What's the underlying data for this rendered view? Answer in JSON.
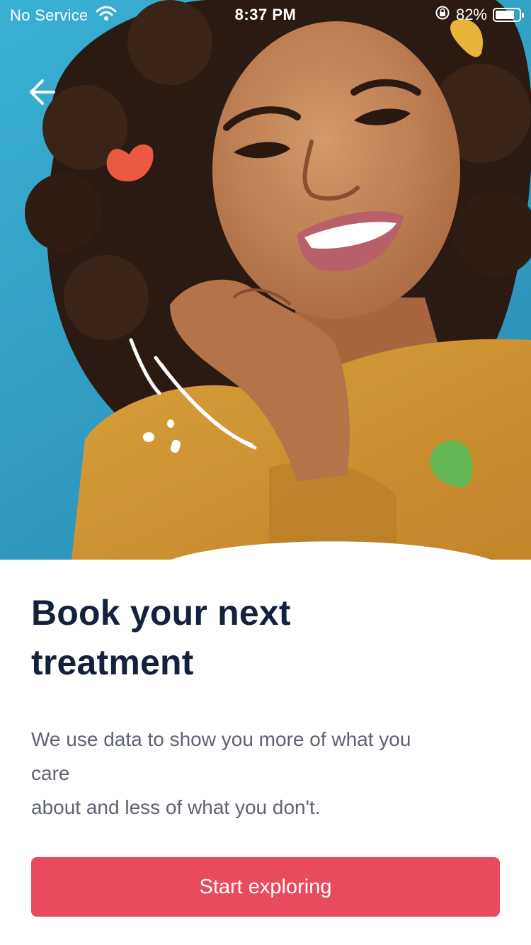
{
  "status_bar": {
    "carrier": "No Service",
    "time": "8:37 PM",
    "battery_percent": "82%",
    "battery_level": 0.82,
    "icons": [
      "wifi-icon",
      "orientation-lock-icon",
      "battery-icon"
    ]
  },
  "hero": {
    "image": "woman-smiling-photo",
    "back_icon": "back-arrow-icon",
    "decorations": [
      "red-leaf-icon",
      "yellow-leaf-icon",
      "green-leaf-icon",
      "white-strokes-icon"
    ]
  },
  "onboarding": {
    "title_line1": "Book your next",
    "title_line2": "treatment",
    "description_line1": "We use data to show you more of what you",
    "description_line2": "care",
    "description_line3": "about and less of what you don't.",
    "cta_label": "Start exploring"
  },
  "colors": {
    "title": "#14213d",
    "body_text": "#5e6372",
    "cta_background": "#e94b5e",
    "cta_text": "#ffffff",
    "hero_background": "#3aa7c9",
    "accent_red": "#ea5a40",
    "accent_yellow": "#e8b43a",
    "accent_green": "#66b857"
  }
}
